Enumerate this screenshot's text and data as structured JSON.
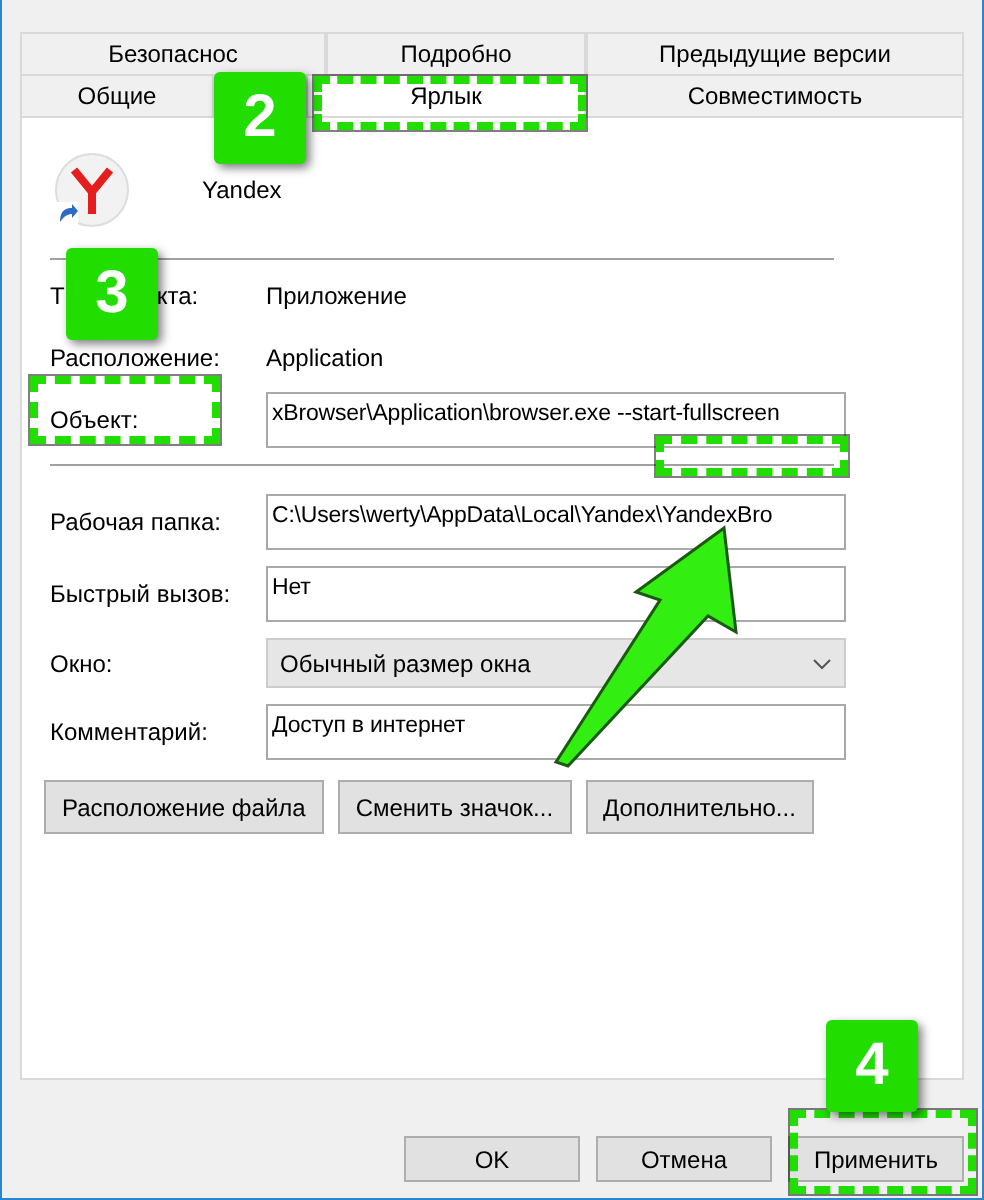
{
  "tab_rows": [
    [
      {
        "label": "Безопаснос",
        "selected": false
      },
      {
        "label": "Подробно",
        "selected": false
      },
      {
        "label": "Предыдущие версии",
        "selected": false
      }
    ],
    [
      {
        "label": "Общие",
        "selected": false
      },
      {
        "label": "Ярлык",
        "selected": true
      },
      {
        "label": "Совместимость",
        "selected": false
      }
    ]
  ],
  "app_name": "Yandex",
  "info": [
    {
      "label_parts": [
        "Т",
        "кта:"
      ],
      "value": "Приложение"
    },
    {
      "label_parts": [
        "Расположение:"
      ],
      "value": "Application"
    }
  ],
  "target": {
    "label": "Объект:",
    "value": "xBrowser\\Application\\browser.exe --start-fullscreen"
  },
  "fields": [
    {
      "kind": "input",
      "label": "Рабочая папка:",
      "value": "C:\\Users\\werty\\AppData\\Local\\Yandex\\YandexBro"
    },
    {
      "kind": "input",
      "label": "Быстрый вызов:",
      "value": "Нет"
    },
    {
      "kind": "select",
      "label": "Окно:",
      "value": "Обычный размер окна"
    },
    {
      "kind": "input",
      "label": "Комментарий:",
      "value": "Доступ в интернет"
    }
  ],
  "actions": [
    "Расположение файла",
    "Сменить значок...",
    "Дополнительно..."
  ],
  "footer_buttons": [
    "OK",
    "Отмена",
    "Применить"
  ],
  "badges": [
    {
      "label": "2"
    },
    {
      "label": "3"
    },
    {
      "label": "4"
    }
  ]
}
